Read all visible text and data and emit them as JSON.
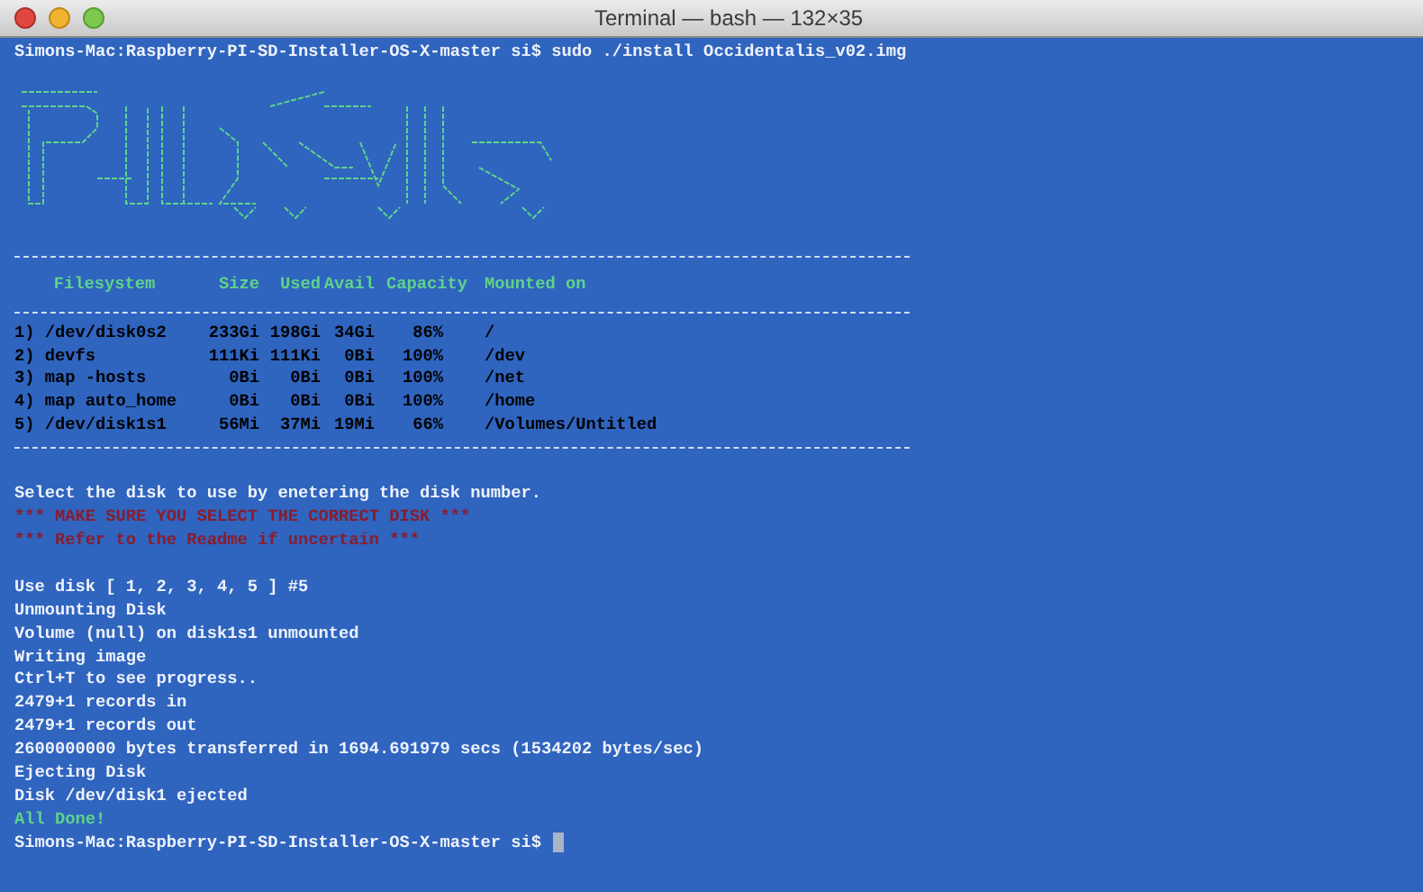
{
  "window": {
    "title": "Terminal — bash — 132×35"
  },
  "lines": [
    {
      "kind": "plain",
      "text": "Simons-Mac:Raspberry-PI-SD-Installer-OS-X-master si$ sudo ./install Occidentalis_v02.img"
    },
    {
      "kind": "blank"
    },
    {
      "kind": "logo"
    },
    {
      "kind": "blank"
    },
    {
      "kind": "rule"
    },
    {
      "kind": "table",
      "columns": [
        "Filesystem",
        "Size",
        "Used",
        "Avail",
        "Capacity",
        "Mounted on"
      ],
      "rows": [
        [
          "1) /dev/disk0s2",
          "233Gi",
          "198Gi",
          "34Gi",
          "86%",
          "/"
        ],
        [
          "2) devfs",
          "111Ki",
          "111Ki",
          "0Bi",
          "100%",
          "/dev"
        ],
        [
          "3) map -hosts",
          "0Bi",
          "0Bi",
          "0Bi",
          "100%",
          "/net"
        ],
        [
          "4) map auto_home",
          "0Bi",
          "0Bi",
          "0Bi",
          "100%",
          "/home"
        ],
        [
          "5) /dev/disk1s1",
          "56Mi",
          "37Mi",
          "19Mi",
          "66%",
          "/Volumes/Untitled"
        ]
      ]
    },
    {
      "kind": "rule"
    },
    {
      "kind": "blank"
    },
    {
      "kind": "plain",
      "text": "Select the disk to use by enetering the disk number."
    },
    {
      "kind": "warning",
      "text": "*** MAKE SURE YOU SELECT THE CORRECT DISK ***"
    },
    {
      "kind": "warning",
      "text": "*** Refer to the Readme if uncertain ***"
    },
    {
      "kind": "blank"
    },
    {
      "kind": "plain",
      "text": "Use disk [ 1, 2, 3, 4, 5 ] #5"
    },
    {
      "kind": "plain",
      "text": "Unmounting Disk"
    },
    {
      "kind": "plain",
      "text": "Volume (null) on disk1s1 unmounted"
    },
    {
      "kind": "plain",
      "text": "Writing image"
    },
    {
      "kind": "plain",
      "text": "Ctrl+T to see progress.."
    },
    {
      "kind": "plain",
      "text": "2479+1 records in"
    },
    {
      "kind": "plain",
      "text": "2479+1 records out"
    },
    {
      "kind": "plain",
      "text": "2600000000 bytes transferred in 1694.691979 secs (1534202 bytes/sec)"
    },
    {
      "kind": "plain",
      "text": "Ejecting Disk"
    },
    {
      "kind": "plain",
      "text": "Disk /dev/disk1 ejected"
    },
    {
      "kind": "success",
      "text": "All Done!"
    },
    {
      "kind": "prompt",
      "text": "Simons-Mac:Raspberry-PI-SD-Installer-OS-X-master si$"
    }
  ]
}
